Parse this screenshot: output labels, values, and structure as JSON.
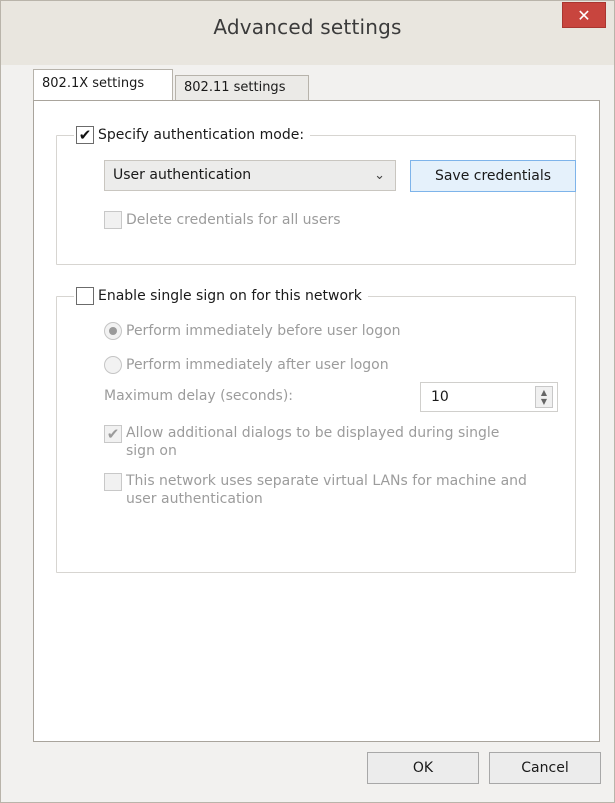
{
  "window": {
    "title": "Advanced settings",
    "close_glyph": "✕"
  },
  "tabs": [
    {
      "label": "802.1X settings",
      "active": true
    },
    {
      "label": "802.11 settings",
      "active": false
    }
  ],
  "auth": {
    "checkbox_label": "Specify authentication mode:",
    "checked": true,
    "mode_value": "User authentication",
    "save_label": "Save credentials",
    "delete_label": "Delete credentials for all users"
  },
  "sso": {
    "checkbox_label": "Enable single sign on for this network",
    "checked": false,
    "radio_before": "Perform immediately before user logon",
    "radio_after": "Perform immediately after user logon",
    "delay_label": "Maximum delay (seconds):",
    "delay_value": "10",
    "allow_label": "Allow additional dialogs to be displayed during single sign on",
    "vlan_label": "This network uses separate virtual LANs for machine and user authentication"
  },
  "footer": {
    "ok_label": "OK",
    "cancel_label": "Cancel"
  },
  "icons": {
    "check": "✔",
    "chevron": "⌄",
    "spin_up": "▲",
    "spin_down": "▼"
  },
  "colors": {
    "close": "#c8453e",
    "focus_border": "#7eb4ea"
  }
}
